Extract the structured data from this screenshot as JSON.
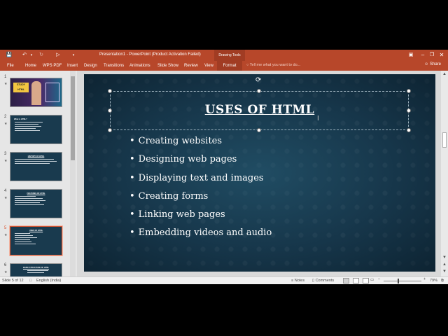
{
  "titlebar": {
    "doc_title": "Presentation1 - PowerPoint (Product Activation Failed)",
    "drawing_tools": "Drawing Tools",
    "icons": [
      "save-icon",
      "undo-icon",
      "redo-icon",
      "start-from-beginning-icon",
      "customize-qat-icon"
    ]
  },
  "ribbon": {
    "tabs": [
      "File",
      "Home",
      "WPS PDF",
      "Insert",
      "Design",
      "Transitions",
      "Animations",
      "Slide Show",
      "Review",
      "View"
    ],
    "format_tab": "Format",
    "tell_me": "Tell me what you want to do...",
    "share": "Share"
  },
  "thumbnails": [
    {
      "num": "1",
      "title": "STUDY HTML"
    },
    {
      "num": "2",
      "title": "What is HTML?"
    },
    {
      "num": "3",
      "title": "HISTORY OF HTML"
    },
    {
      "num": "4",
      "title": "FEATURES OF HTML"
    },
    {
      "num": "5",
      "title": "USES OF HTML"
    },
    {
      "num": "6",
      "title": "BASIC STRUCTURE OF HTML"
    }
  ],
  "slide": {
    "title": "USES OF HTML",
    "bullets": [
      "Creating websites",
      "Designing web pages",
      "Displaying text and images",
      "Creating forms",
      "Linking web pages",
      "Embedding videos and audio"
    ]
  },
  "statusbar": {
    "slide_info": "Slide 5 of 12",
    "language": "English (India)",
    "notes": "Notes",
    "comments": "Comments",
    "zoom": "79%",
    "zoom_fraction": 0.79
  },
  "colors": {
    "accent": "#b7472a",
    "slide_bg": "#17364a",
    "selected_thumb_border": "#d65532"
  }
}
